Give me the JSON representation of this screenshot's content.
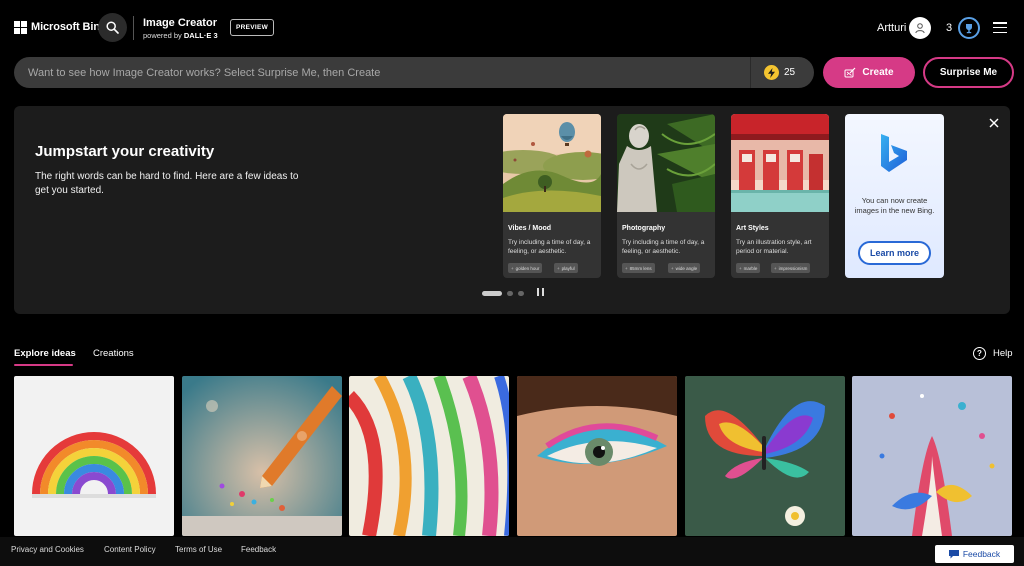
{
  "header": {
    "brand": "Microsoft Bing",
    "app_title": "Image Creator",
    "app_sub_prefix": "powered by ",
    "app_sub_bold": "DALL·E 3",
    "preview_badge": "PREVIEW",
    "user_name": "Artturi",
    "reward_count": "3"
  },
  "prompt": {
    "placeholder": "Want to see how Image Creator works? Select Surprise Me, then Create",
    "boost_count": "25",
    "create_label": "Create",
    "surprise_label": "Surprise Me"
  },
  "jumpstart": {
    "title": "Jumpstart your creativity",
    "description": "The right words can be hard to find. Here are a few ideas to get you started.",
    "cards": [
      {
        "category": "Vibes / Mood",
        "tip": "Try including a time of day, a feeling, or aesthetic.",
        "chips": [
          "golden hour",
          "playful"
        ]
      },
      {
        "category": "Photography",
        "tip": "Try including a time of day, a feeling, or aesthetic.",
        "chips": [
          "85mm lens",
          "wide angle"
        ]
      },
      {
        "category": "Art Styles",
        "tip": "Try an illustration style, art period or material.",
        "chips": [
          "marble",
          "impressionism"
        ]
      }
    ],
    "bing_card": {
      "text": "You can now create images in the new Bing.",
      "button": "Learn more"
    }
  },
  "tabs": {
    "explore": "Explore ideas",
    "creations": "Creations",
    "help": "Help"
  },
  "footer": {
    "links": [
      "Privacy and Cookies",
      "Content Policy",
      "Terms of Use",
      "Feedback"
    ],
    "feedback_button": "Feedback"
  },
  "colors": {
    "accent": "#d63a86",
    "panel": "#1c1c1c",
    "prompt_bg": "#3b3b3b"
  }
}
